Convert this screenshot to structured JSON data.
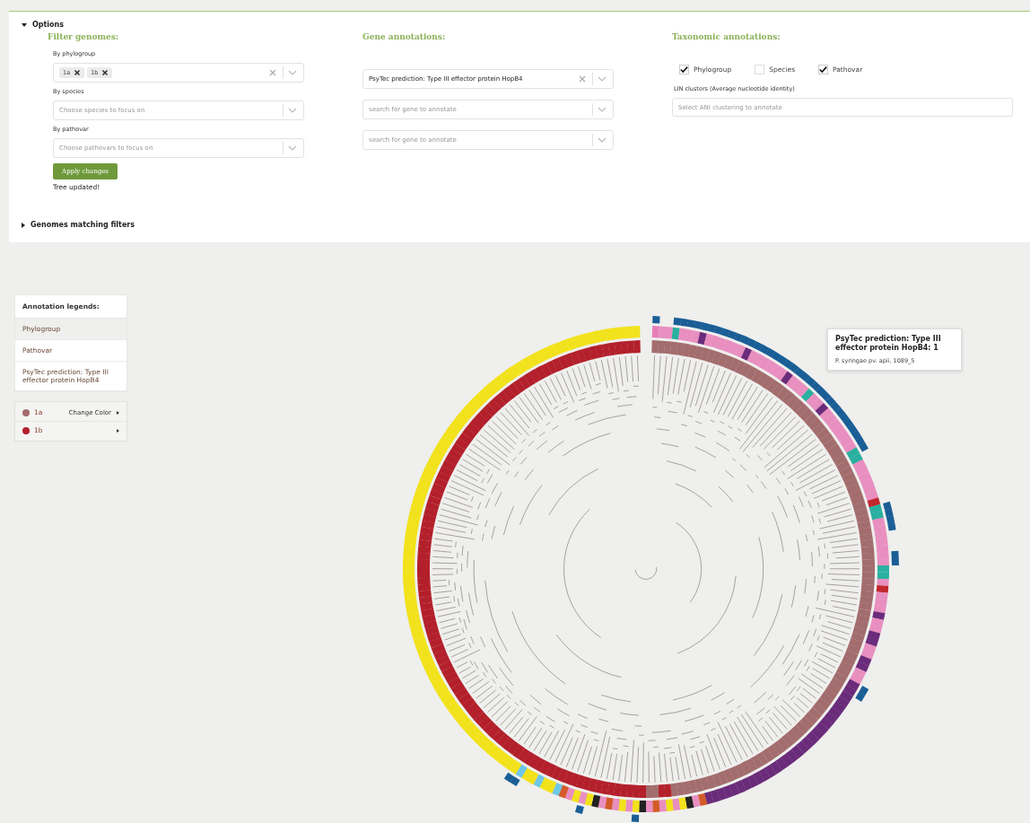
{
  "options": {
    "label": "Options",
    "expanded": true
  },
  "filter": {
    "heading": "Filter genomes:",
    "fields": [
      {
        "label": "By phylogroup",
        "tags": [
          "1a",
          "1b"
        ],
        "clearable": true
      },
      {
        "label": "By species",
        "placeholder": "Choose species to focus on"
      },
      {
        "label": "By pathovar",
        "placeholder": "Choose pathovars to focus on"
      }
    ],
    "button": "Apply changes",
    "status": "Tree updated!"
  },
  "gene": {
    "heading": "Gene annotations:",
    "fields": [
      {
        "value": "PsyTec prediction: Type III effector protein HopB4",
        "clearable": true
      },
      {
        "placeholder": "search for gene to annotate"
      },
      {
        "placeholder": "search for gene to annotate"
      }
    ]
  },
  "taxonomic": {
    "heading": "Taxonomic annotations:",
    "checkboxes": [
      {
        "label": "Phylogroup",
        "checked": true
      },
      {
        "label": "Species",
        "checked": false
      },
      {
        "label": "Pathovar",
        "checked": true
      }
    ],
    "lin_label": "LIN clusters (Average nucleotide identity)",
    "lin_placeholder": "Select ANI clustering to annotate"
  },
  "genomes_matching": {
    "label": "Genomes matching filters",
    "expanded": false
  },
  "legend": {
    "title": "Annotation legends:",
    "tabs": [
      {
        "label": "Phylogroup",
        "selected": true
      },
      {
        "label": "Pathovar",
        "selected": false
      },
      {
        "label": "PsyTec prediction: Type III effector protein HopB4",
        "selected": false
      }
    ],
    "items": [
      {
        "label": "1a",
        "color": "#a36d6e",
        "action": "Change Color"
      },
      {
        "label": "1b",
        "color": "#b3202b"
      }
    ]
  },
  "tooltip": {
    "title": "PsyTec prediction: Type III effector protein HopB4: 1",
    "detail": "P. syringae pv. apii, 1089_5"
  }
}
